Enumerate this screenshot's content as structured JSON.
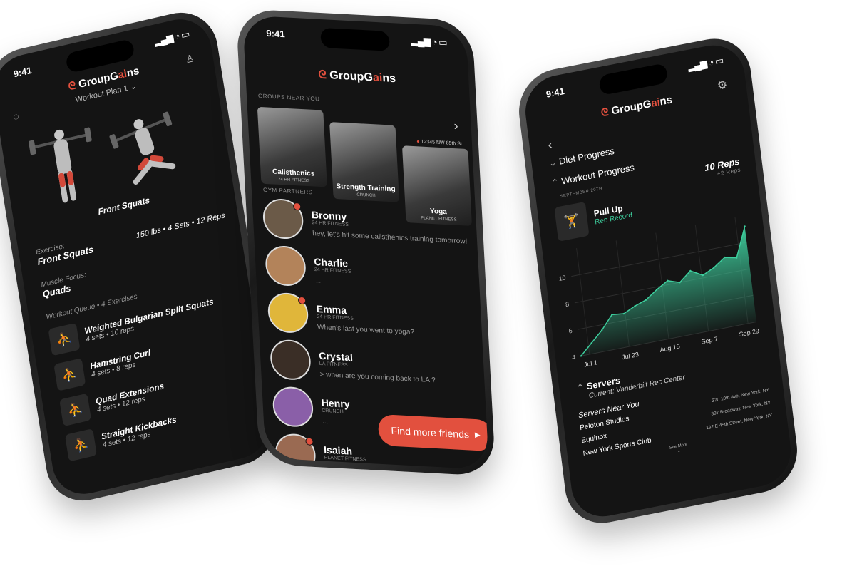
{
  "brand": {
    "prefix": "GroupG",
    "highlight": "ai",
    "suffix": "ns",
    "accent": "#e2503e",
    "teal": "#3ecf9e"
  },
  "status": {
    "time": "9:41"
  },
  "phone1": {
    "plan": "Workout Plan 1 ⌄",
    "hero_title": "Front Squats",
    "exercise_label": "Exercise:",
    "exercise_value": "Front Squats",
    "stats": "150 lbs • 4 Sets • 12 Reps",
    "muscle_label": "Muscle Focus:",
    "muscle_value": "Quads",
    "queue_title": "Workout Queue • 4 Exercises",
    "queue": [
      {
        "name": "Weighted Bulgarian Split Squats",
        "sub": "4 sets • 10 reps"
      },
      {
        "name": "Hamstring Curl",
        "sub": "4 sets • 8 reps"
      },
      {
        "name": "Quad Extensions",
        "sub": "4 sets • 12 reps"
      },
      {
        "name": "Straight Kickbacks",
        "sub": "4 sets • 12 reps"
      }
    ]
  },
  "phone2": {
    "groups_title": "GROUPS NEAR YOU",
    "location": "12345 NW 85th St",
    "groups": [
      {
        "name": "Calisthenics",
        "gym": "24 HR FITNESS"
      },
      {
        "name": "Strength Training",
        "gym": "CRUNCH"
      },
      {
        "name": "Yoga",
        "gym": "PLANET FITNESS"
      }
    ],
    "partners_title": "GYM PARTNERS",
    "friends": [
      {
        "name": "Bronny",
        "gym": "24 HR FITNESS",
        "msg": "hey, let's hit some calisthenics training tomorrow!"
      },
      {
        "name": "Charlie",
        "gym": "24 HR FITNESS",
        "msg": "..."
      },
      {
        "name": "Emma",
        "gym": "24 HR FITNESS",
        "msg": "When's last you went to yoga?"
      },
      {
        "name": "Crystal",
        "gym": "LA FITNESS",
        "msg": "> when are you coming back to LA ?"
      },
      {
        "name": "Henry",
        "gym": "CRUNCH",
        "msg": "..."
      },
      {
        "name": "Isaiah",
        "gym": "PLANET FITNESS",
        "msg": ""
      }
    ],
    "cta": "Find more friends"
  },
  "phone3": {
    "diet": "Diet Progress",
    "workout": "Workout Progress",
    "date": "SEPTEMBER 29TH",
    "reps": "10 Reps",
    "reps_delta": "+2 Reps",
    "exercise": "Pull Up",
    "record": "Rep Record",
    "servers_title": "Servers",
    "current": "Current: Vanderbilt Rec Center",
    "near_title": "Servers Near You",
    "servers": [
      {
        "name": "Peloton Studios",
        "addr": "370 10th Ave, New York, NY"
      },
      {
        "name": "Equinox",
        "addr": "897 Broadway, New York, NY"
      },
      {
        "name": "New York Sports Club",
        "addr": "132 E 45th Street, New York, NY"
      }
    ],
    "see_more": "See More"
  },
  "chart_data": {
    "type": "area",
    "x": [
      "Jul 1",
      "Jul 23",
      "Aug 15",
      "Sep 7",
      "Sep 29"
    ],
    "y_ticks": [
      4,
      6,
      8,
      10
    ],
    "ylim": [
      4,
      12
    ],
    "values": [
      4.0,
      4.8,
      5.6,
      6.6,
      6.5,
      6.9,
      7.2,
      7.8,
      8.3,
      8.0,
      8.7,
      8.2,
      8.6,
      9.2,
      9.0,
      11.2
    ],
    "color": "#3ecf9e"
  }
}
